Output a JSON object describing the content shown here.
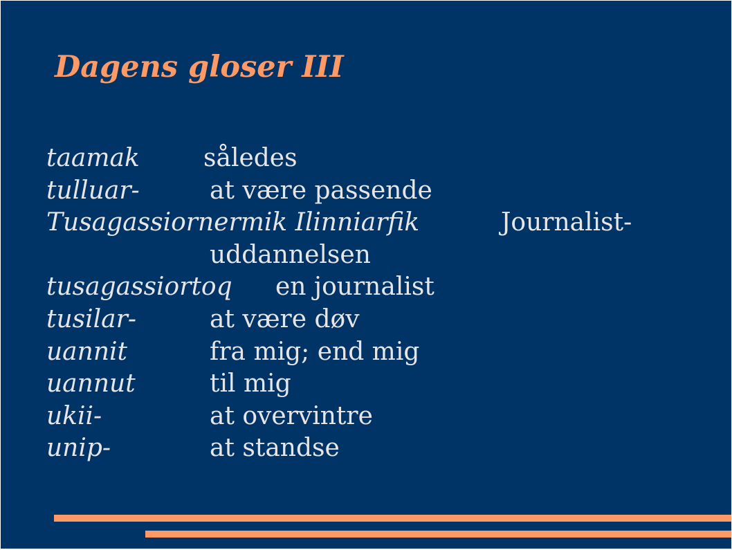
{
  "title": "Dagens gloser III",
  "entries": [
    {
      "term": "taamak",
      "meaning": "således"
    },
    {
      "term": "tulluar-",
      "meaning": "at være passende"
    },
    {
      "term": "Tusagassiornermik Ilinniarfik",
      "meaning": "Journalist-"
    },
    {
      "term": "",
      "meaning": "uddannelsen"
    },
    {
      "term": "tusagassiortoq",
      "meaning": "en journalist"
    },
    {
      "term": "tusilar-",
      "meaning": "at være døv"
    },
    {
      "term": "uannit",
      "meaning": "fra mig; end mig"
    },
    {
      "term": "uannut",
      "meaning": "til mig"
    },
    {
      "term": "ukii-",
      "meaning": "at overvintre"
    },
    {
      "term": "unip-",
      "meaning": "at standse"
    }
  ],
  "colors": {
    "background": "#003366",
    "accent": "#ff9966",
    "text": "#e6e6e6"
  }
}
